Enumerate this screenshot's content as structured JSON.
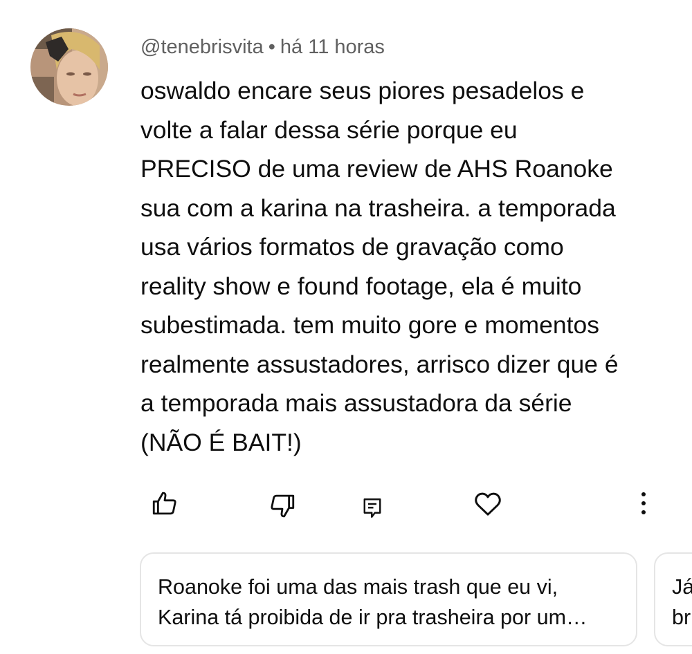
{
  "comment": {
    "author": "@tenebrisvita",
    "separator": "•",
    "timestamp": "há 11 horas",
    "lines": [
      "oswaldo encare seus piores pesadelos e",
      "volte a falar dessa série porque eu",
      "PRECISO de uma review de AHS Roanoke",
      "sua com a karina na trasheira. a temporada",
      "usa vários formatos de gravação como",
      "reality show e found footage, ela é muito",
      "subestimada. tem muito gore e momentos",
      "realmente assustadores, arrisco dizer que é",
      "a temporada mais assustadora da série",
      "(NÃO É BAIT!)"
    ]
  },
  "actions": {
    "like_icon": "thumbs-up-icon",
    "dislike_icon": "thumbs-down-icon",
    "reply_icon": "comment-icon",
    "heart_icon": "heart-icon",
    "more_icon": "more-vert-icon"
  },
  "replies": [
    {
      "lines": [
        "Roanoke foi uma das mais trash que eu vi,",
        "Karina tá proibida de ir pra trasheira por um…"
      ]
    },
    {
      "lines": [
        "Já",
        "br"
      ]
    }
  ],
  "colors": {
    "text": "#0f0f0f",
    "meta": "#606060",
    "card_border": "#e5e5e5"
  }
}
